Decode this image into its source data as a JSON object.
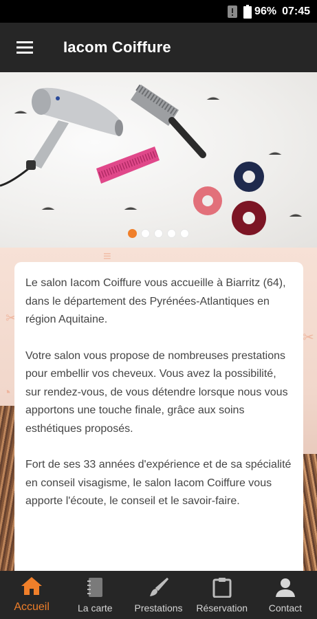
{
  "status_bar": {
    "battery_percent": "96%",
    "time": "07:45",
    "icons": [
      "notification-icon",
      "battery-icon"
    ]
  },
  "app_bar": {
    "title": "Iacom Coiffure",
    "menu_icon": "hamburger-menu-icon"
  },
  "hero": {
    "slide_count": 5,
    "active_slide": 1
  },
  "content": {
    "paragraphs": [
      "Le salon Iacom Coiffure vous accueille à Biarritz (64), dans le département des Pyrénées-Atlantiques en région Aquitaine.",
      "Votre salon vous propose de nombreuses prestations pour embellir vos cheveux. Vous avez la possibilité, sur rendez-vous, de vous détendre lorsque nous vous apportons une touche finale, grâce aux soins esthétiques proposés.",
      "Fort de ses 33 années d'expérience et de sa spécialité en conseil visagisme, le salon Iacom Coiffure vous apporte l'écoute, le conseil et le savoir-faire."
    ]
  },
  "bottom_nav": {
    "items": [
      {
        "label": "Accueil",
        "icon": "home-icon",
        "active": true
      },
      {
        "label": "La carte",
        "icon": "notebook-icon",
        "active": false
      },
      {
        "label": "Prestations",
        "icon": "brush-icon",
        "active": false
      },
      {
        "label": "Réservation",
        "icon": "clipboard-icon",
        "active": false
      },
      {
        "label": "Contact",
        "icon": "person-icon",
        "active": false
      }
    ]
  },
  "colors": {
    "accent": "#f07f2a",
    "app_bar": "#262626",
    "status_bar": "#000000",
    "nav_text": "#d6d6d6",
    "card_text": "#444444"
  }
}
